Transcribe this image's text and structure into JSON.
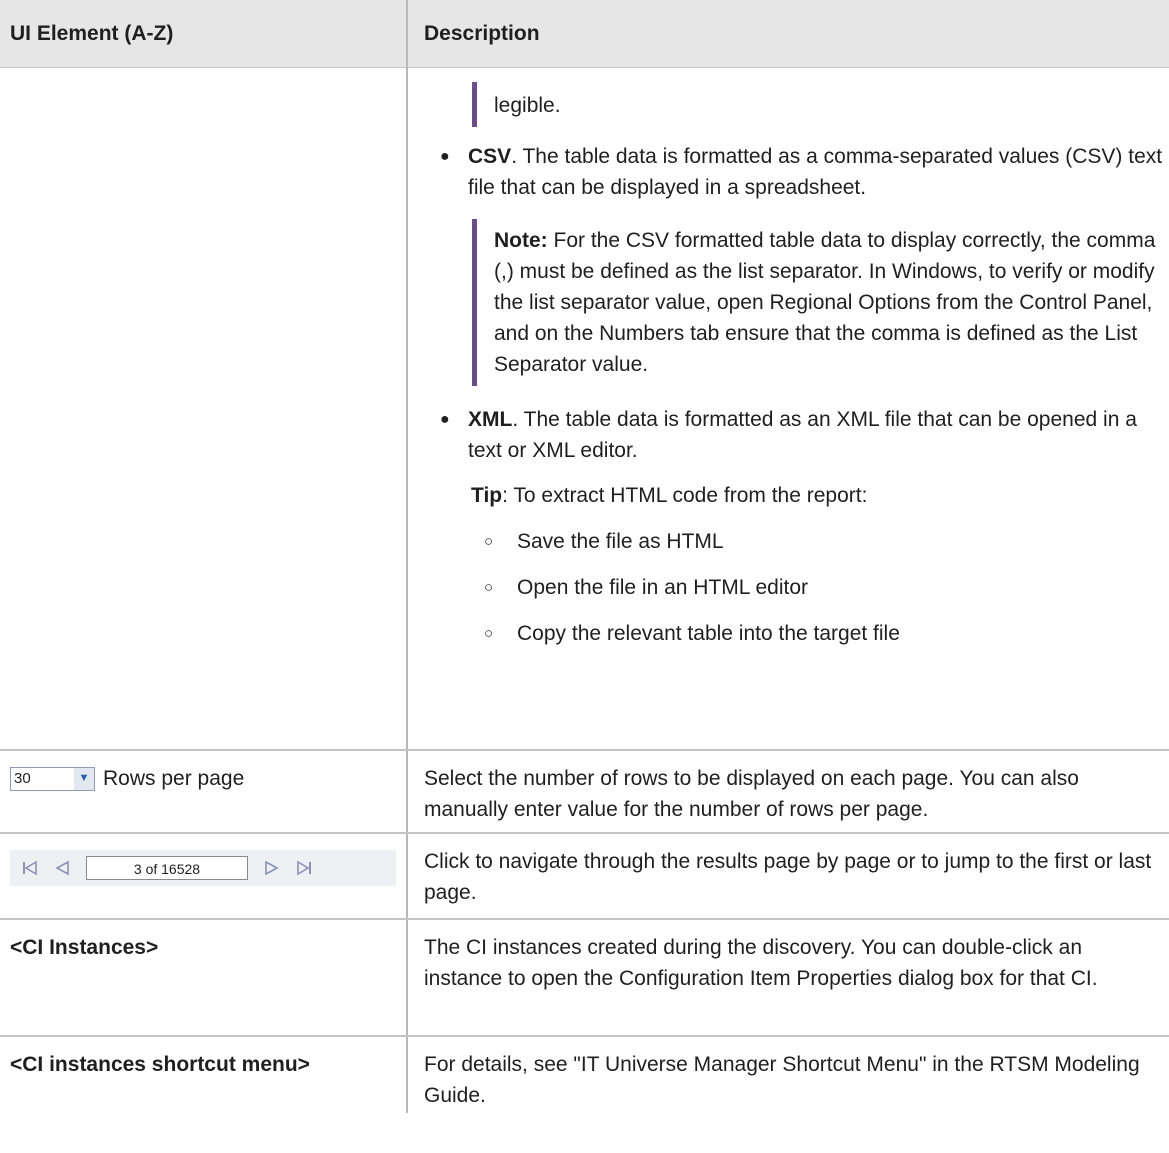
{
  "header": {
    "col1": "UI Element (A-Z)",
    "col2": "Description"
  },
  "top_row": {
    "legible": "legible.",
    "csv_term": "CSV",
    "csv_text": ". The table data is formatted as a comma-separated values (CSV) text file that can be displayed in a spreadsheet.",
    "note_label": "Note:",
    "note_text": " For the CSV formatted table data to display correctly, the comma (,) must be defined as the list separator. In Windows, to verify or modify the list separator value, open Regional Options from the Control Panel, and on the Numbers tab ensure that the comma is defined as the List Separator value.",
    "xml_term": "XML",
    "xml_text": ". The table data is formatted as an XML file that can be opened in a text or XML editor.",
    "tip_label": "Tip",
    "tip_text": ": To extract HTML code from the report:",
    "sub_items": [
      "Save the file as HTML",
      "Open the file in an HTML editor",
      "Copy the relevant table into the target file"
    ]
  },
  "rows_per_page": {
    "select_value": "30",
    "label": "Rows per page",
    "description": "Select the number of rows to be displayed on each page. You can also manually enter value for the number of rows per page."
  },
  "navigation": {
    "page_field": "3 of 16528",
    "description": "Click to navigate through the results page by page or to jump to the first or last page."
  },
  "ci_instances": {
    "element": "<CI Instances>",
    "description": "The CI instances created during the discovery. You can double-click an instance to open the Configuration Item Properties dialog box for that CI."
  },
  "ci_shortcut": {
    "element": "<CI instances shortcut menu>",
    "description": "For details, see \"IT Universe Manager Shortcut Menu\" in the RTSM Modeling Guide."
  },
  "glyphs": {
    "bullet": "●",
    "sub_bullet": "○"
  }
}
